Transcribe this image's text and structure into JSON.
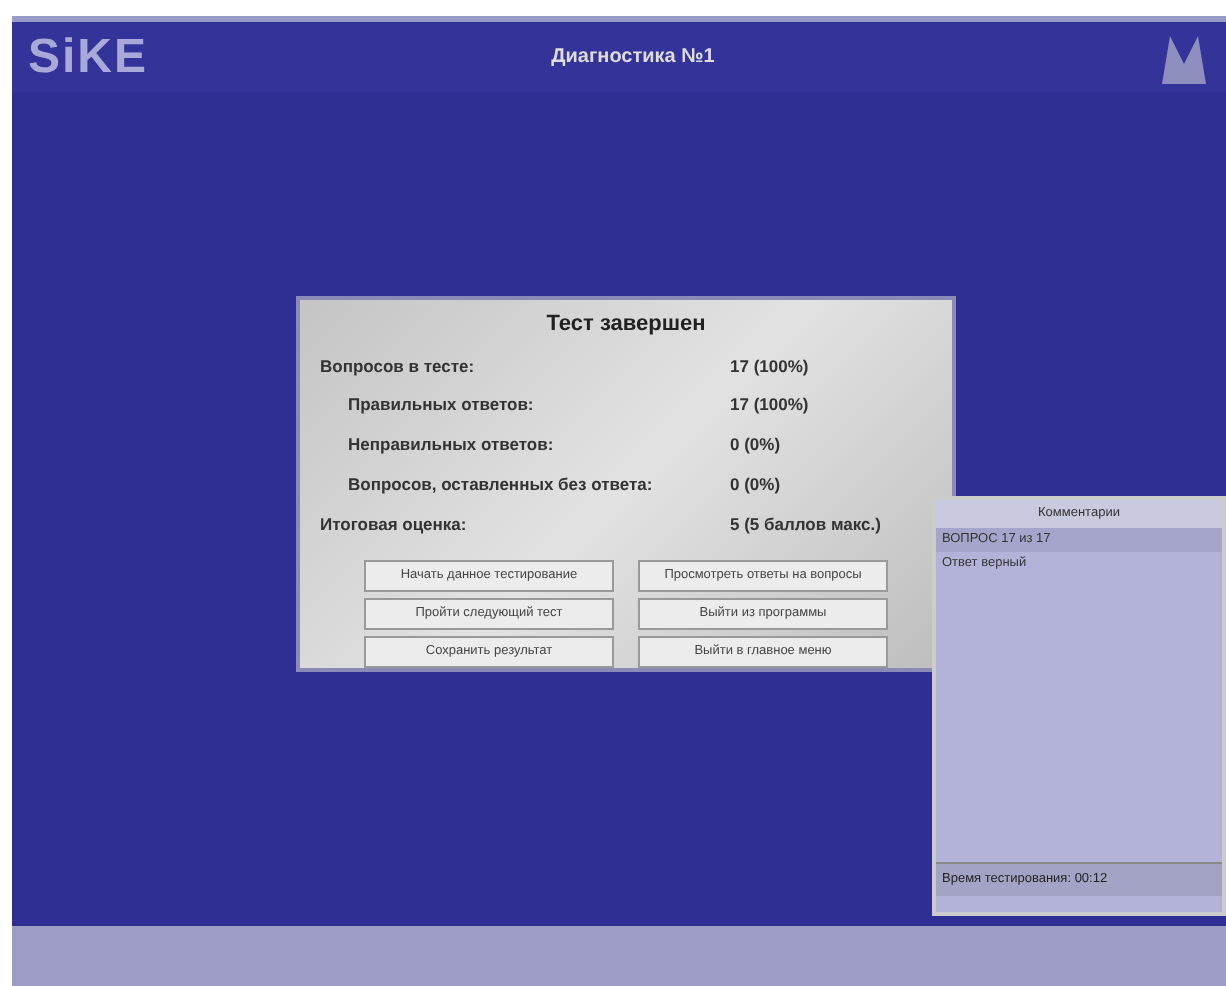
{
  "header": {
    "logo": "SiKE",
    "title": "Диагностика №1"
  },
  "dialog": {
    "title": "Тест завершен",
    "stats": [
      {
        "label": "Вопросов в тесте:",
        "value": "17 (100%)",
        "indented": false
      },
      {
        "label": "Правильных ответов:",
        "value": "17 (100%)",
        "indented": true
      },
      {
        "label": "Неправильных ответов:",
        "value": "0 (0%)",
        "indented": true
      },
      {
        "label": "Вопросов, оставленных без ответа:",
        "value": "0 (0%)",
        "indented": true
      },
      {
        "label": "Итоговая оценка:",
        "value": "5 (5 баллов макс.)",
        "indented": false
      }
    ],
    "buttons": [
      "Начать данное тестирование",
      "Просмотреть ответы на вопросы",
      "Пройти следующий тест",
      "Выйти из программы",
      "Сохранить результат",
      "Выйти в главное меню"
    ]
  },
  "side_panel": {
    "title": "Комментарии",
    "lines": [
      "ВОПРОС 17 из 17",
      "Ответ верный"
    ],
    "status": "Время тестирования: 00:12"
  }
}
